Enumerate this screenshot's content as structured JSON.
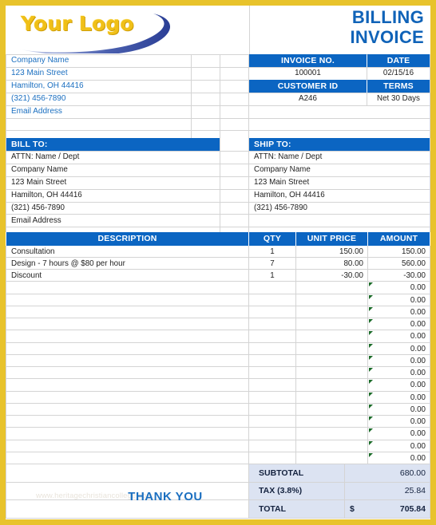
{
  "header": {
    "logo_text": "Your Logo",
    "title_line1": "BILLING",
    "title_line2": "INVOICE",
    "accent_blue": "#0b65c2",
    "accent_yellow": "#e8c32c",
    "logo_yellow": "#f0c018"
  },
  "company": {
    "lines": [
      "Company Name",
      "123 Main Street",
      "Hamilton, OH  44416",
      "(321) 456-7890",
      "Email Address"
    ]
  },
  "invoice_meta": {
    "invoice_no_label": "INVOICE NO.",
    "date_label": "DATE",
    "invoice_no_value": "100001",
    "date_value": "02/15/16",
    "customer_id_label": "CUSTOMER ID",
    "terms_label": "TERMS",
    "customer_id_value": "A246",
    "terms_value": "Net 30 Days"
  },
  "bill_to": {
    "heading": "BILL TO:",
    "lines": [
      "ATTN: Name / Dept",
      "Company Name",
      "123 Main Street",
      "Hamilton, OH  44416",
      "(321) 456-7890",
      "Email Address"
    ]
  },
  "ship_to": {
    "heading": "SHIP TO:",
    "lines": [
      "ATTN: Name / Dept",
      "Company Name",
      "123 Main Street",
      "Hamilton, OH  44416",
      "(321) 456-7890",
      ""
    ]
  },
  "items_table": {
    "columns": [
      "DESCRIPTION",
      "QTY",
      "UNIT PRICE",
      "AMOUNT"
    ],
    "rows": [
      {
        "description": "Consultation",
        "qty": "1",
        "unit_price": "150.00",
        "amount": "150.00",
        "flag": false
      },
      {
        "description": "Design - 7 hours @ $80 per hour",
        "qty": "7",
        "unit_price": "80.00",
        "amount": "560.00",
        "flag": false
      },
      {
        "description": "Discount",
        "qty": "1",
        "unit_price": "-30.00",
        "amount": "-30.00",
        "flag": false
      },
      {
        "description": "",
        "qty": "",
        "unit_price": "",
        "amount": "0.00",
        "flag": true
      },
      {
        "description": "",
        "qty": "",
        "unit_price": "",
        "amount": "0.00",
        "flag": true
      },
      {
        "description": "",
        "qty": "",
        "unit_price": "",
        "amount": "0.00",
        "flag": true
      },
      {
        "description": "",
        "qty": "",
        "unit_price": "",
        "amount": "0.00",
        "flag": true
      },
      {
        "description": "",
        "qty": "",
        "unit_price": "",
        "amount": "0.00",
        "flag": true
      },
      {
        "description": "",
        "qty": "",
        "unit_price": "",
        "amount": "0.00",
        "flag": true
      },
      {
        "description": "",
        "qty": "",
        "unit_price": "",
        "amount": "0.00",
        "flag": true
      },
      {
        "description": "",
        "qty": "",
        "unit_price": "",
        "amount": "0.00",
        "flag": true
      },
      {
        "description": "",
        "qty": "",
        "unit_price": "",
        "amount": "0.00",
        "flag": true
      },
      {
        "description": "",
        "qty": "",
        "unit_price": "",
        "amount": "0.00",
        "flag": true
      },
      {
        "description": "",
        "qty": "",
        "unit_price": "",
        "amount": "0.00",
        "flag": true
      },
      {
        "description": "",
        "qty": "",
        "unit_price": "",
        "amount": "0.00",
        "flag": true
      },
      {
        "description": "",
        "qty": "",
        "unit_price": "",
        "amount": "0.00",
        "flag": true
      },
      {
        "description": "",
        "qty": "",
        "unit_price": "",
        "amount": "0.00",
        "flag": true
      },
      {
        "description": "",
        "qty": "",
        "unit_price": "",
        "amount": "0.00",
        "flag": true
      }
    ]
  },
  "totals": {
    "subtotal_label": "SUBTOTAL",
    "subtotal_value": "680.00",
    "tax_label": "TAX (3.8%)",
    "tax_value": "25.84",
    "total_label": "TOTAL",
    "total_currency": "$",
    "total_value": "705.84"
  },
  "footer": {
    "thank_you": "THANK YOU",
    "watermark": "www.heritagechristiancollege.com"
  }
}
